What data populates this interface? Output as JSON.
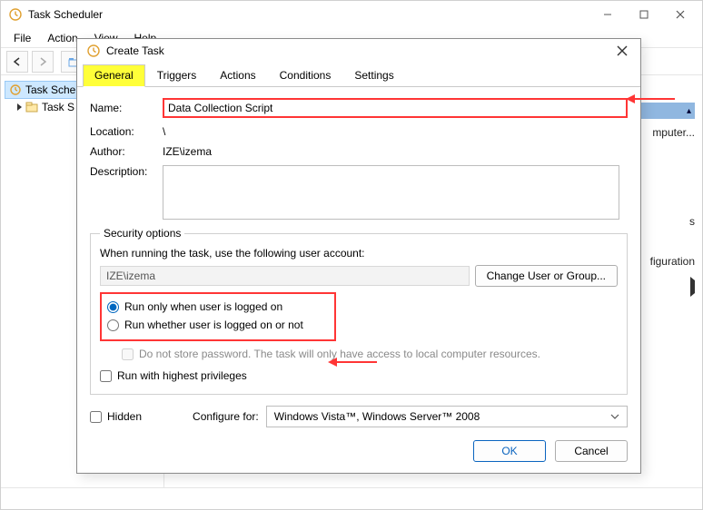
{
  "main_window": {
    "title": "Task Scheduler",
    "menu": [
      "File",
      "Action",
      "View",
      "Help"
    ],
    "tree": {
      "root": "Task Sche",
      "child": "Task S"
    },
    "right_stubs": {
      "s1": "mputer...",
      "s2": "s",
      "s3": "figuration"
    },
    "bluebar_glyph": "▴"
  },
  "dialog": {
    "title": "Create Task",
    "tabs": [
      "General",
      "Triggers",
      "Actions",
      "Conditions",
      "Settings"
    ],
    "labels": {
      "name": "Name:",
      "location": "Location:",
      "author": "Author:",
      "description": "Description:"
    },
    "values": {
      "name": "Data Collection Script",
      "location": "\\",
      "author": "IZE\\izema"
    },
    "security": {
      "legend": "Security options",
      "when_running": "When running the task, use the following user account:",
      "account": "IZE\\izema",
      "change_btn": "Change User or Group...",
      "radio_logged_on": "Run only when user is logged on",
      "radio_whether": "Run whether user is logged on or not",
      "no_store": "Do not store password.  The task will only have access to local computer resources.",
      "highest": "Run with highest privileges"
    },
    "hidden_label": "Hidden",
    "configure_label": "Configure for:",
    "configure_value": "Windows Vista™, Windows Server™ 2008",
    "ok": "OK",
    "cancel": "Cancel"
  }
}
